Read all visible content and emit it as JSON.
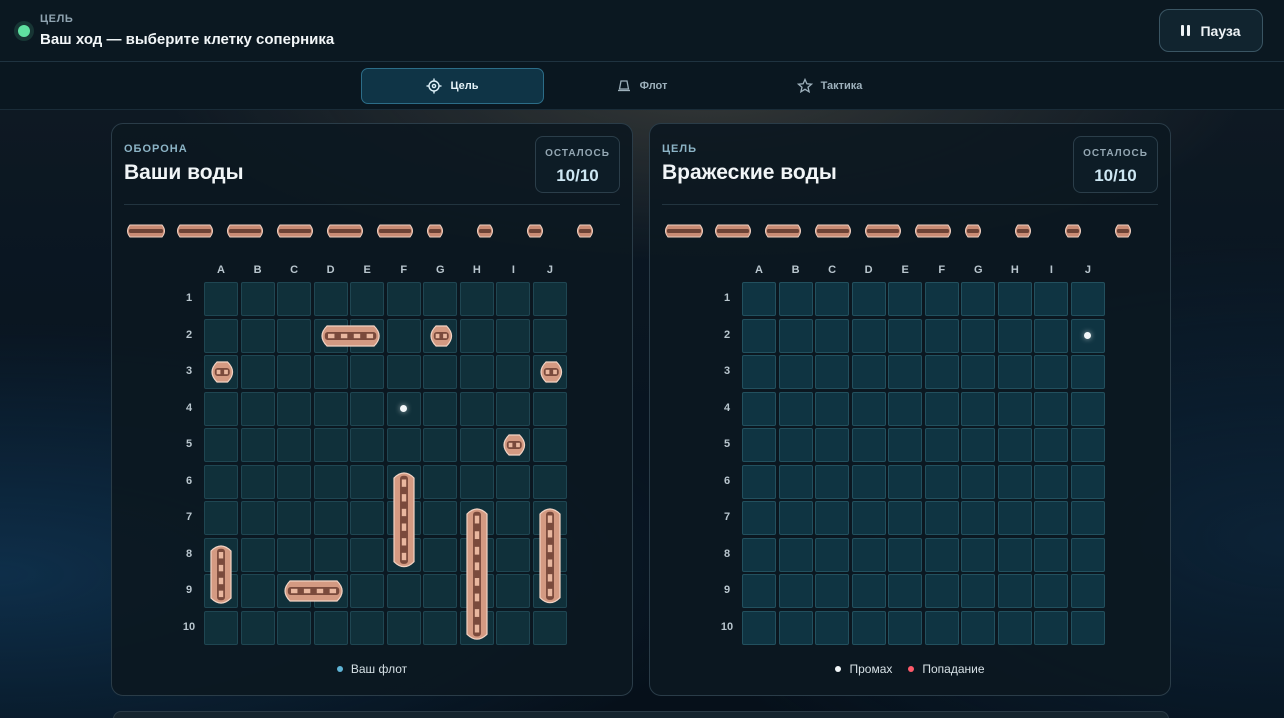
{
  "header": {
    "mode_label": "ЦЕЛЬ",
    "turn_text": "Ваш ход — выберите клетку соперника",
    "pause_label": "Пауза",
    "status_color": "#5fe0a0"
  },
  "tabs": [
    {
      "label": "Цель",
      "icon": "crosshair-icon",
      "active": true
    },
    {
      "label": "Флот",
      "icon": "ship-icon",
      "active": false
    },
    {
      "label": "Тактика",
      "icon": "star-icon",
      "active": false
    }
  ],
  "columns": [
    "A",
    "B",
    "C",
    "D",
    "E",
    "F",
    "G",
    "H",
    "I",
    "J"
  ],
  "rows": [
    "1",
    "2",
    "3",
    "4",
    "5",
    "6",
    "7",
    "8",
    "9",
    "10"
  ],
  "defense": {
    "kicker": "ОБОРОНА",
    "title": "Ваши воды",
    "remaining_label": "ОСТАЛОСЬ",
    "remaining_value": "10/10",
    "ships": [
      {
        "col": 3,
        "row": 1,
        "length": 2,
        "orientation": "horizontal"
      },
      {
        "col": 6,
        "row": 1,
        "length": 1,
        "orientation": "horizontal"
      },
      {
        "col": 0,
        "row": 2,
        "length": 1,
        "orientation": "horizontal"
      },
      {
        "col": 9,
        "row": 2,
        "length": 1,
        "orientation": "horizontal"
      },
      {
        "col": 8,
        "row": 4,
        "length": 1,
        "orientation": "horizontal"
      },
      {
        "col": 5,
        "row": 5,
        "length": 3,
        "orientation": "vertical"
      },
      {
        "col": 7,
        "row": 6,
        "length": 4,
        "orientation": "vertical"
      },
      {
        "col": 9,
        "row": 6,
        "length": 3,
        "orientation": "vertical"
      },
      {
        "col": 0,
        "row": 7,
        "length": 2,
        "orientation": "vertical"
      },
      {
        "col": 2,
        "row": 8,
        "length": 2,
        "orientation": "horizontal"
      }
    ],
    "misses": [
      {
        "col": 5,
        "row": 3
      }
    ],
    "legend": [
      {
        "label": "Ваш флот",
        "color": "#5fb4d6"
      }
    ]
  },
  "target": {
    "kicker": "ЦЕЛЬ",
    "title": "Вражеские воды",
    "remaining_label": "ОСТАЛОСЬ",
    "remaining_value": "10/10",
    "misses": [
      {
        "col": 9,
        "row": 1
      }
    ],
    "legend": [
      {
        "label": "Промах",
        "color": "#f2f6f8"
      },
      {
        "label": "Попадание",
        "color": "#ff5a6a"
      }
    ]
  },
  "fleet_roster": [
    4,
    3,
    3,
    2,
    2,
    2,
    1,
    1,
    1,
    1
  ]
}
